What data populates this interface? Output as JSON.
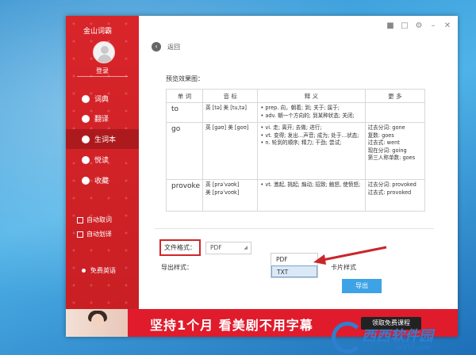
{
  "app": {
    "title": "金山词霸",
    "login": "登录",
    "back": "返回"
  },
  "sidebar": {
    "items": [
      {
        "label": "词典",
        "icon": "dictionary-icon",
        "active": false
      },
      {
        "label": "翻译",
        "icon": "translate-icon",
        "active": false
      },
      {
        "label": "生词本",
        "icon": "wordbook-icon",
        "active": true
      },
      {
        "label": "悦读",
        "icon": "reading-icon",
        "active": false
      },
      {
        "label": "收藏",
        "icon": "favorite-icon",
        "active": false
      }
    ],
    "options": [
      {
        "label": "自动取词"
      },
      {
        "label": "自动划译"
      }
    ],
    "free_english": "免费英语"
  },
  "preview": {
    "label": "预览效果图：",
    "headers": [
      "单 词",
      "音 标",
      "释 义",
      "更 多"
    ],
    "rows": [
      {
        "word": "to",
        "phonetic": "英 [tə] 美 [tu,tə]",
        "meanings": [
          "• prep. 向，朝着; 到; 关于; 属于;",
          "• adv. 朝一个方向的; 到某种状态; 关闭;"
        ],
        "more": []
      },
      {
        "word": "go",
        "phonetic": "英 [gəʊ] 美 [goʊ]",
        "meanings": [
          "• vi. 走; 离开; 去做; 进行;",
          "• vt. 变得; 发出…声音; 成为; 处于…状态;",
          "• n. 轮到的顺序; 精力; 干劲; 尝试;"
        ],
        "more": [
          "过去分词: gone",
          "复数: goes",
          "过去式: went",
          "现在分词: going",
          "第三人称单数: goes"
        ]
      },
      {
        "word": "provoke",
        "phonetic_lines": [
          "英 [prəˈvəʊk]",
          "美 [prəˈvoʊk]"
        ],
        "meanings": [
          "• vt. 激起, 挑起; 煽动; 招致; 触怒, 使愤怒;"
        ],
        "more": [
          "过去分词: provoked",
          "过去式: provoked"
        ]
      }
    ]
  },
  "export_form": {
    "format_label": "文件格式：",
    "format_value": "PDF",
    "options": [
      "PDF",
      "TXT"
    ],
    "style_label": "导出样式：",
    "style_value": "卡片样式",
    "export_button": "导出"
  },
  "banner": {
    "slogan": "坚持1个月 看美剧不用字幕",
    "cta": "领取免费课程"
  },
  "watermark": {
    "text": "西西软件园",
    "sub": "cr173.com"
  },
  "colors": {
    "sidebar_red": "#d8252a",
    "accent_blue": "#3ea3e6",
    "highlight_red": "#d0262a"
  }
}
